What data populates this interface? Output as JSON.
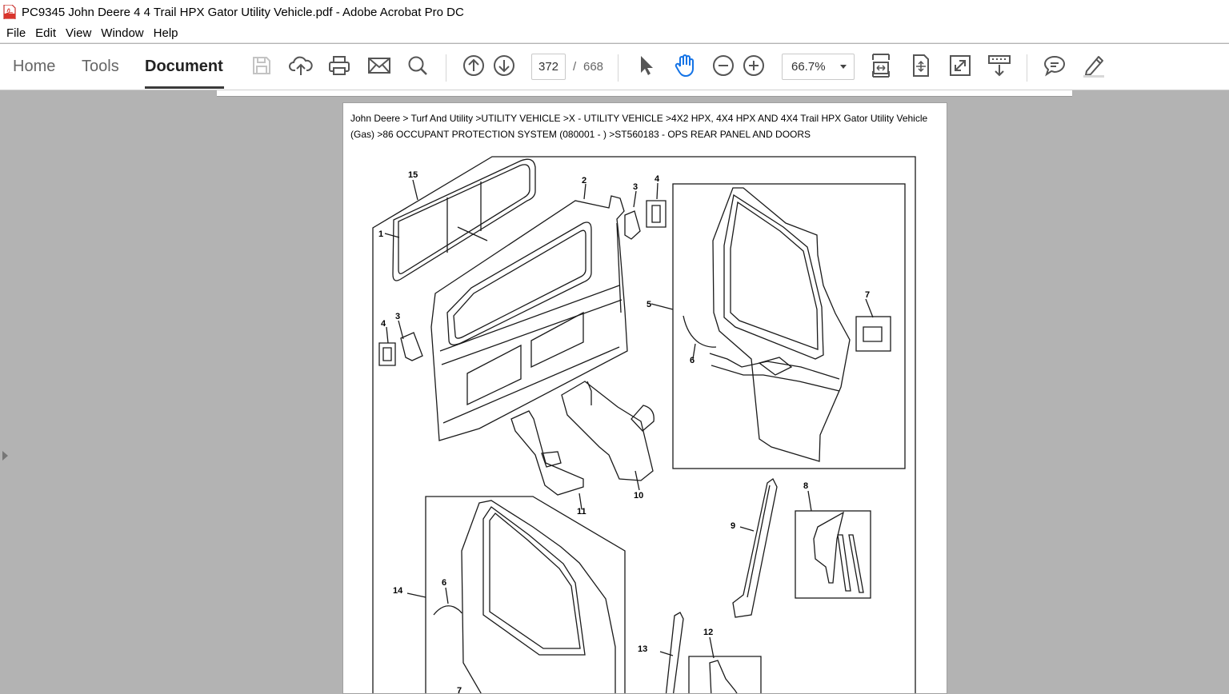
{
  "window": {
    "title": "PC9345 John Deere 4 4 Trail HPX Gator Utility Vehicle.pdf - Adobe Acrobat Pro DC",
    "app_icon": "pdf-file-icon"
  },
  "menu": {
    "items": [
      {
        "label": "File"
      },
      {
        "label": "Edit"
      },
      {
        "label": "View"
      },
      {
        "label": "Window"
      },
      {
        "label": "Help"
      }
    ]
  },
  "nav_tabs": [
    {
      "label": "Home",
      "active": false
    },
    {
      "label": "Tools",
      "active": false
    },
    {
      "label": "Document",
      "active": true
    }
  ],
  "toolbar": {
    "icons": [
      "save-icon",
      "cloud-upload-icon",
      "print-icon",
      "email-icon",
      "search-icon",
      "page-up-icon",
      "page-down-icon",
      "select-cursor-icon",
      "hand-tool-icon",
      "zoom-out-icon",
      "zoom-in-icon",
      "fit-page-icon",
      "scroll-mode-icon",
      "full-screen-icon",
      "read-mode-icon",
      "comment-icon",
      "highlight-pen-icon"
    ],
    "current_page": "372",
    "page_separator": "/",
    "total_pages": "668",
    "zoom_level": "66.7%",
    "accent_color": "#1473e6"
  },
  "document": {
    "breadcrumb": "John Deere > Turf And Utility >UTILITY VEHICLE >X - UTILITY VEHICLE >4X2 HPX, 4X4 HPX AND 4X4 Trail HPX Gator Utility Vehicle (Gas) >86 OCCUPANT PROTECTION SYSTEM (080001 - ) >ST560183 - OPS REAR PANEL AND DOORS",
    "callouts": [
      {
        "label": "15"
      },
      {
        "label": "2"
      },
      {
        "label": "3"
      },
      {
        "label": "4"
      },
      {
        "label": "1"
      },
      {
        "label": "4"
      },
      {
        "label": "3"
      },
      {
        "label": "5"
      },
      {
        "label": "7"
      },
      {
        "label": "6"
      },
      {
        "label": "10"
      },
      {
        "label": "11"
      },
      {
        "label": "8"
      },
      {
        "label": "9"
      },
      {
        "label": "14"
      },
      {
        "label": "6"
      },
      {
        "label": "12"
      },
      {
        "label": "13"
      },
      {
        "label": "7"
      }
    ]
  }
}
